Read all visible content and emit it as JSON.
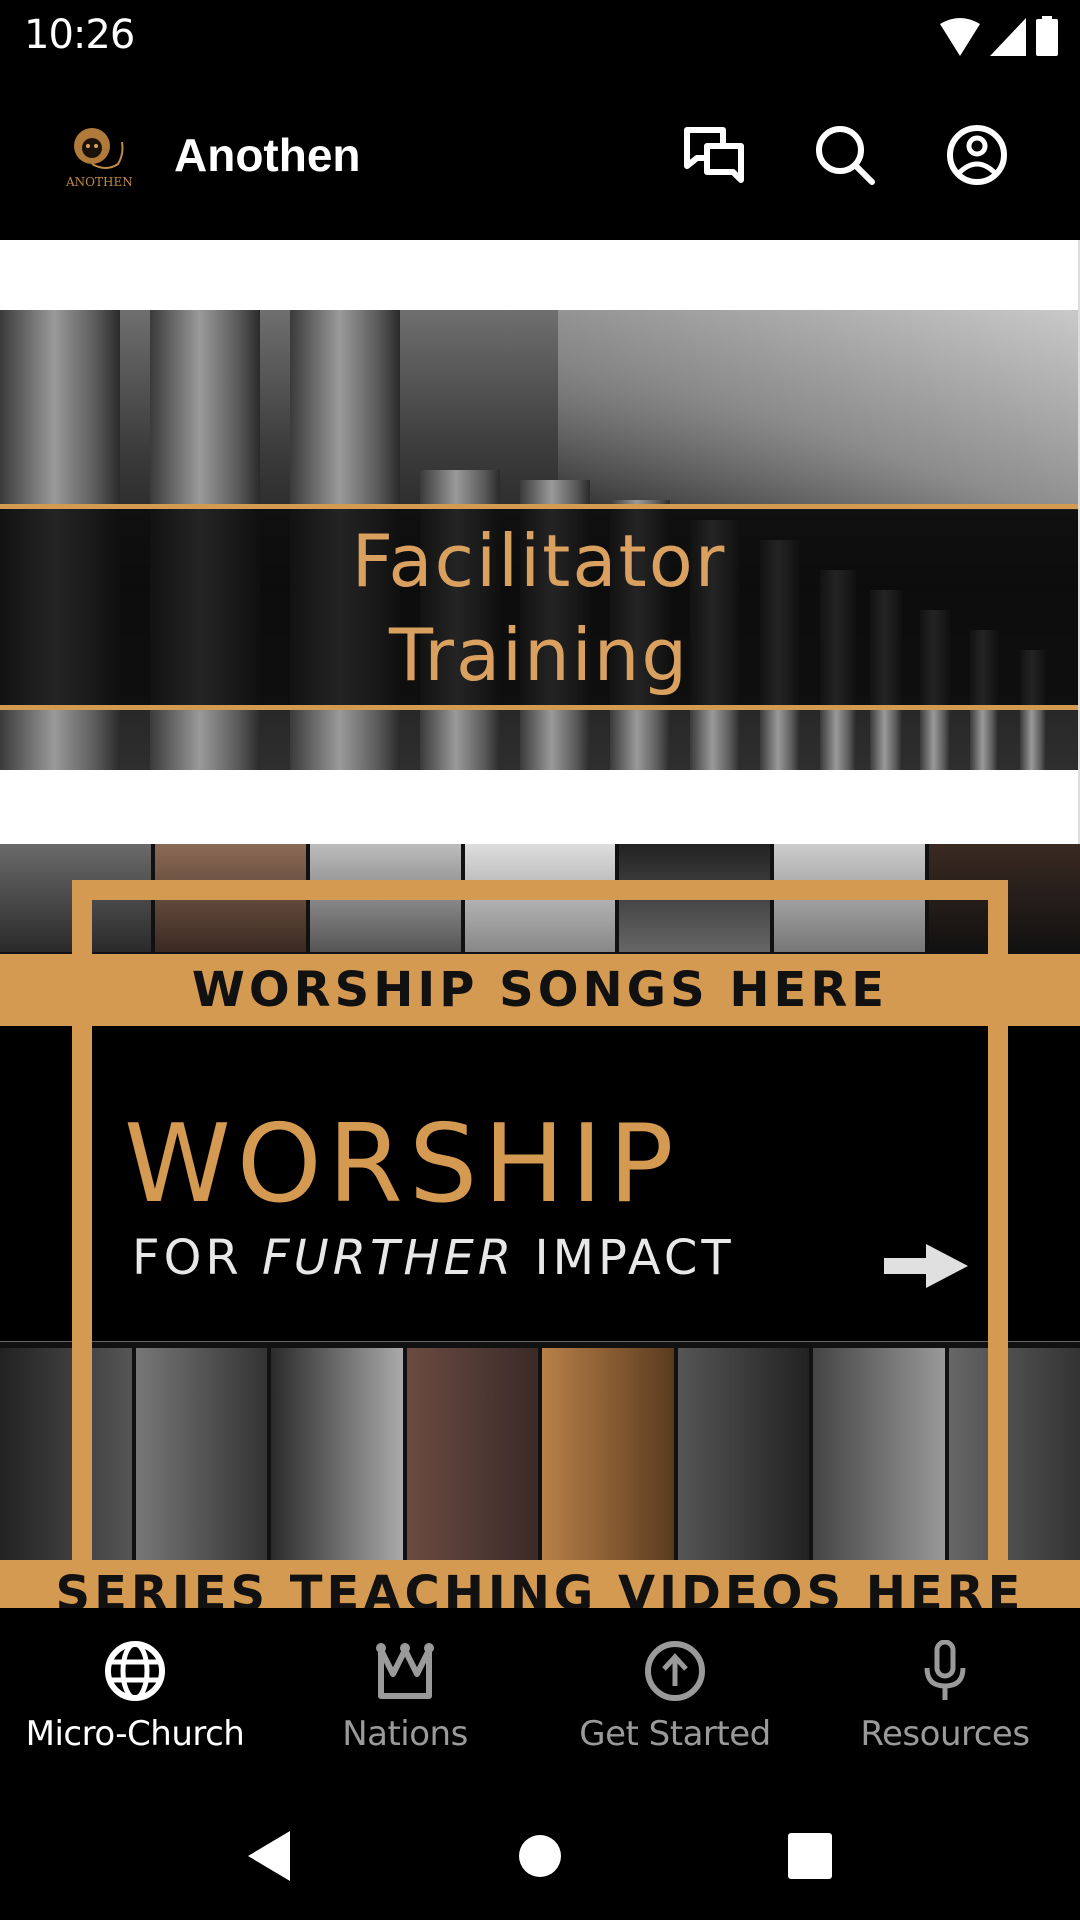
{
  "status_bar": {
    "time": "10:26",
    "icons": [
      "wifi-icon",
      "cellular-signal-icon",
      "battery-icon"
    ]
  },
  "app_bar": {
    "logo_name": "anothen-lion-logo",
    "title": "Anothen",
    "actions": [
      {
        "name": "chat-button",
        "icon": "chat-bubbles-icon"
      },
      {
        "name": "search-button",
        "icon": "search-icon"
      },
      {
        "name": "account-button",
        "icon": "account-circle-icon"
      }
    ]
  },
  "content": {
    "banners": [
      {
        "id": "facilitator-training",
        "line1": "Facilitator",
        "line2": "Training"
      },
      {
        "id": "worship",
        "top_label": "WORSHIP SONGS HERE",
        "title": "WORSHIP",
        "subtitle_pre": "FOR ",
        "subtitle_em": "FURTHER",
        "subtitle_post": " IMPACT",
        "bottom_label": "SERIES TEACHING VIDEOS HERE"
      }
    ]
  },
  "colors": {
    "accent_gold": "#D59A52",
    "background": "#000000",
    "nav_active": "#FFFFFF",
    "nav_inactive": "#9A9A9A"
  },
  "bottom_nav": {
    "active_index": 0,
    "items": [
      {
        "label": "Micro-Church",
        "icon": "globe-icon"
      },
      {
        "label": "Nations",
        "icon": "crown-icon"
      },
      {
        "label": "Get Started",
        "icon": "arrow-up-circle-icon"
      },
      {
        "label": "Resources",
        "icon": "microphone-icon"
      }
    ]
  },
  "system_nav": {
    "buttons": [
      "back-button",
      "home-button",
      "recents-button"
    ]
  }
}
